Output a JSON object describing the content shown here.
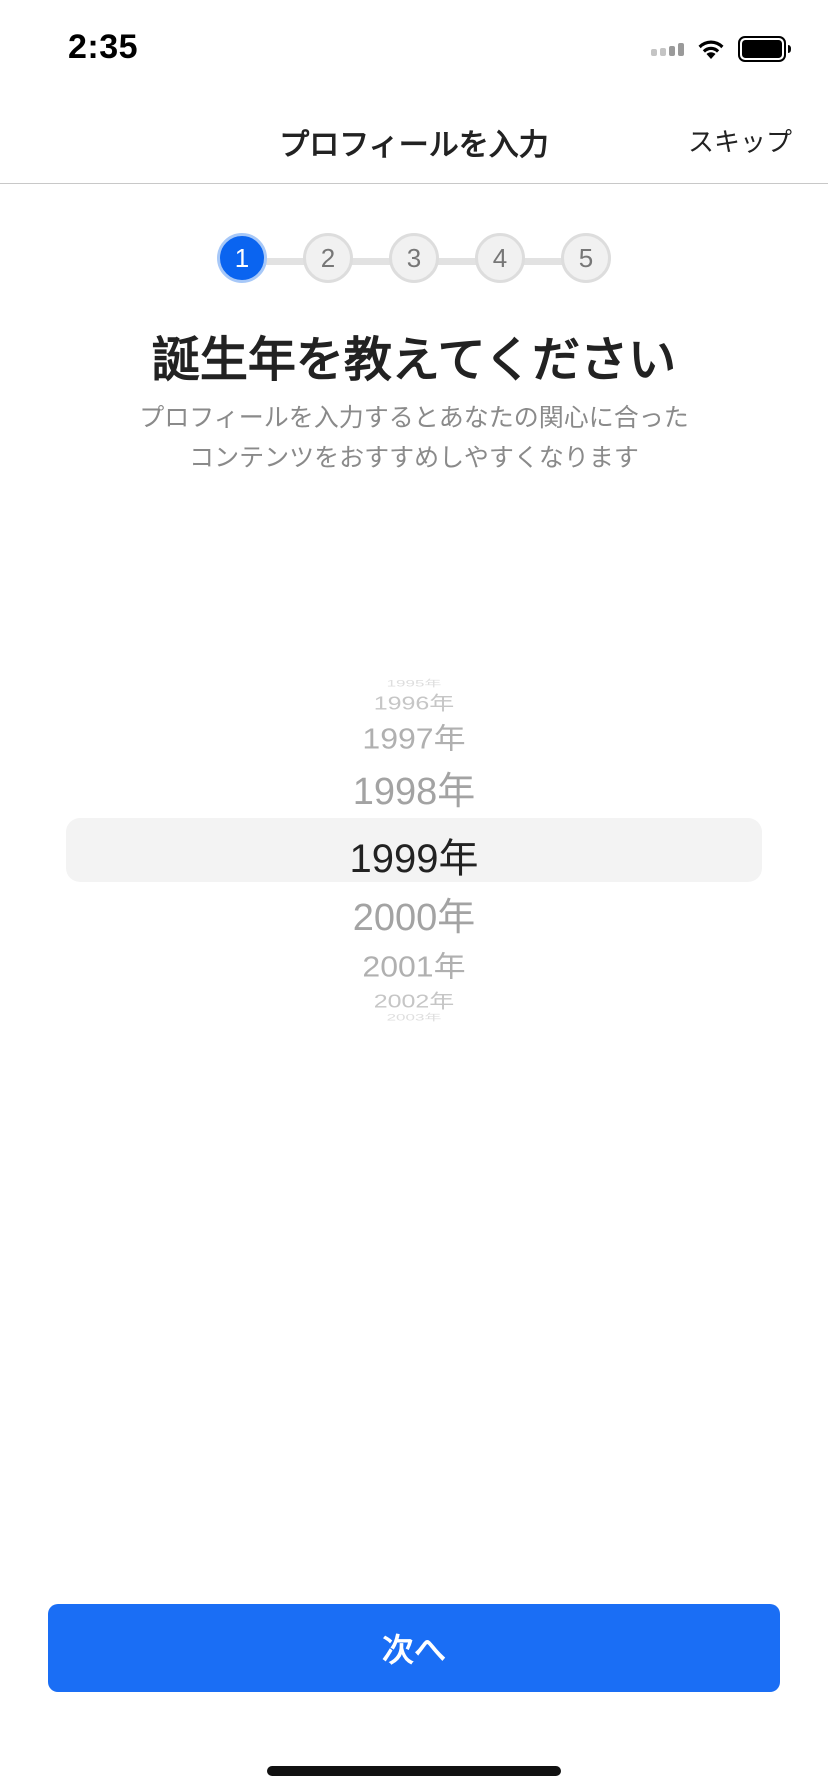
{
  "status_bar": {
    "time": "2:35"
  },
  "nav": {
    "title": "プロフィールを入力",
    "skip_label": "スキップ"
  },
  "stepper": {
    "steps": [
      "1",
      "2",
      "3",
      "4",
      "5"
    ],
    "current_step": 1
  },
  "heading": "誕生年を教えてください",
  "subtext": {
    "line1": "プロフィールを入力するとあなたの関心に合った",
    "line2": "コンテンツをおすすめしやすくなります"
  },
  "picker": {
    "items": [
      "1995年",
      "1996年",
      "1997年",
      "1998年",
      "1999年",
      "2000年",
      "2001年",
      "2002年",
      "2003年"
    ],
    "selected": "1999年"
  },
  "next_button": {
    "label": "次へ"
  },
  "colors": {
    "accent": "#1a6ef5",
    "step_active": "#0a64f0",
    "text_primary": "#222222",
    "text_secondary": "#8a8a8a"
  }
}
